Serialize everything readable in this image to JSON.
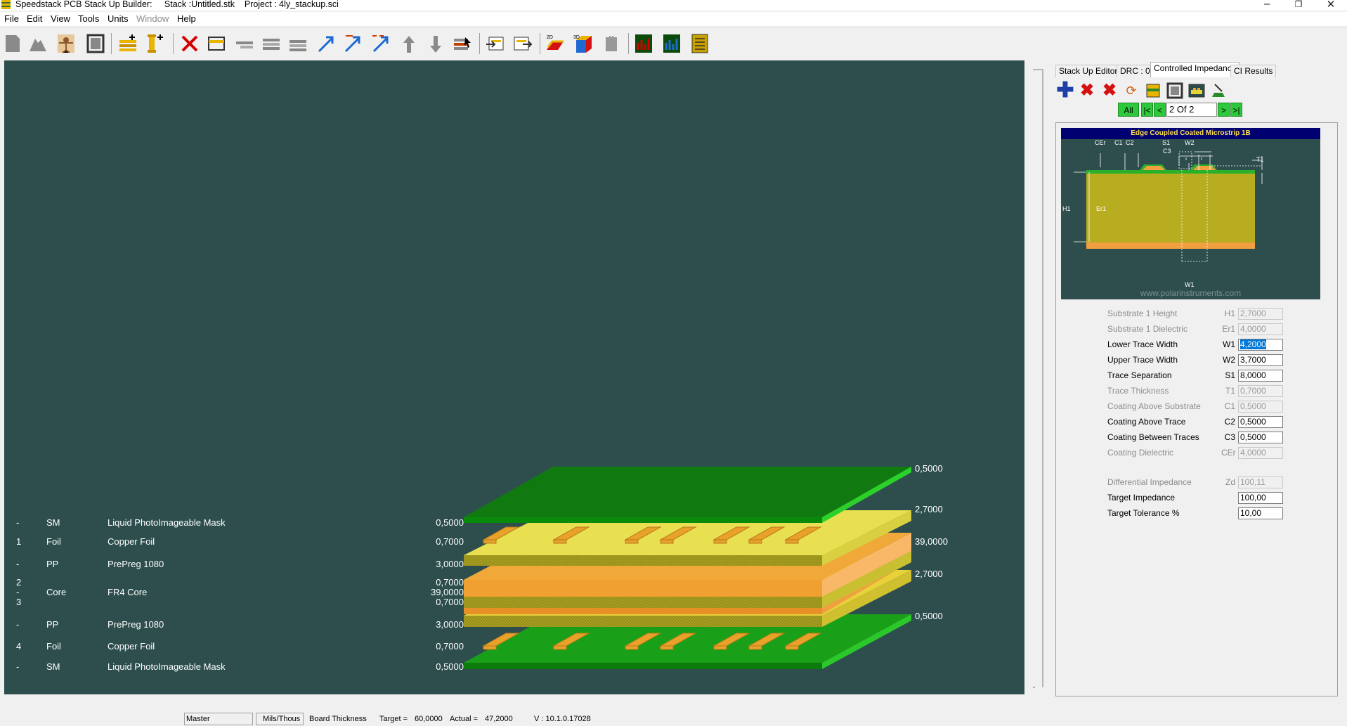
{
  "window": {
    "title": "Speedstack PCB Stack Up Builder:     Stack :Untitled.stk    Project : 4ly_stackup.sci",
    "minimize": "–",
    "restore": "❐",
    "close": "✕"
  },
  "menu": [
    "File",
    "Edit",
    "View",
    "Tools",
    "Units",
    "Window",
    "Help"
  ],
  "stack": {
    "rows": [
      {
        "num": "-",
        "type": "SM",
        "material": "Liquid PhotoImageable Mask",
        "value": "0,5000"
      },
      {
        "num": "1",
        "type": "Foil",
        "material": "Copper Foil",
        "value": "0,7000"
      },
      {
        "num": "-",
        "type": "PP",
        "material": "PrePreg 1080",
        "value": "3,0000"
      },
      {
        "num": "2",
        "type": "",
        "material": "",
        "value": "0,7000"
      },
      {
        "num": "-",
        "type": "Core",
        "material": "FR4 Core",
        "value": "39,0000"
      },
      {
        "num": "3",
        "type": "",
        "material": "",
        "value": "0,7000"
      },
      {
        "num": "-",
        "type": "PP",
        "material": "PrePreg 1080",
        "value": "3,0000"
      },
      {
        "num": "4",
        "type": "Foil",
        "material": "Copper Foil",
        "value": "0,7000"
      },
      {
        "num": "-",
        "type": "SM",
        "material": "Liquid PhotoImageable Mask",
        "value": "0,5000"
      }
    ],
    "right_labels": [
      "0,5000",
      "2,7000",
      "39,0000",
      "2,7000",
      "0,5000"
    ]
  },
  "panel": {
    "tabs": [
      "Stack Up Editor",
      "DRC : 0",
      "Controlled Impedance",
      "CI Results"
    ],
    "nav": {
      "all": "All",
      "first": "|<",
      "prev": "<",
      "page": "2 Of 2",
      "next": ">",
      "last": ">|"
    },
    "diagram": {
      "title": "Edge Coupled Coated Microstrip 1B",
      "labels": {
        "cer": "CEr",
        "c1": "C1",
        "c2": "C2",
        "s1": "S1",
        "c3": "C3",
        "w2": "W2",
        "t1": "T1",
        "h1": "H1",
        "er1": "Er1",
        "w1": "W1"
      },
      "watermark": "www.polarinstruments.com"
    },
    "params": [
      {
        "label": "Substrate 1 Height",
        "sym": "H1",
        "value": "2,7000",
        "enabled": false
      },
      {
        "label": "Substrate 1 Dielectric",
        "sym": "Er1",
        "value": "4,0000",
        "enabled": false
      },
      {
        "label": "Lower Trace Width",
        "sym": "W1",
        "value": "4,2000",
        "enabled": true,
        "selected": true
      },
      {
        "label": "Upper Trace Width",
        "sym": "W2",
        "value": "3,7000",
        "enabled": true
      },
      {
        "label": "Trace Separation",
        "sym": "S1",
        "value": "8,0000",
        "enabled": true
      },
      {
        "label": "Trace Thickness",
        "sym": "T1",
        "value": "0,7000",
        "enabled": false
      },
      {
        "label": "Coating Above Substrate",
        "sym": "C1",
        "value": "0,5000",
        "enabled": false
      },
      {
        "label": "Coating Above Trace",
        "sym": "C2",
        "value": "0,5000",
        "enabled": true
      },
      {
        "label": "Coating Between Traces",
        "sym": "C3",
        "value": "0,5000",
        "enabled": true
      },
      {
        "label": "Coating Dielectric",
        "sym": "CEr",
        "value": "4,0000",
        "enabled": false
      }
    ],
    "results": [
      {
        "label": "Differential Impedance",
        "sym": "Zd",
        "value": "100,11",
        "enabled": false
      },
      {
        "label": "Target Impedance",
        "sym": "",
        "value": "100,00",
        "enabled": true
      },
      {
        "label": "Target Tolerance %",
        "sym": "",
        "value": "10,00",
        "enabled": true
      }
    ]
  },
  "status": {
    "master": "Master",
    "units": "Mils/Thous",
    "board_thickness": "Board Thickness",
    "target_label": "Target =",
    "target_value": "60,0000",
    "actual_label": "Actual =",
    "actual_value": "47,2000",
    "version": "V : 10.1.0.17028"
  }
}
